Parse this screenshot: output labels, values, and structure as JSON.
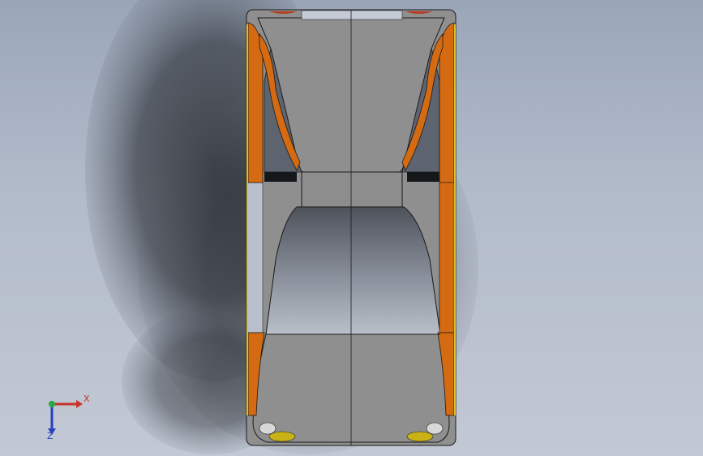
{
  "viewport": {
    "view": "top",
    "background_gradient": [
      "#9aa6b8",
      "#b3bccb",
      "#c2c9d4"
    ]
  },
  "model": {
    "body_color": "#8f8f8f",
    "body_highlight": "#a3a3a3",
    "panel_dark": "#5b6069",
    "accent_orange": "#d46a12",
    "accent_yellow": "#d9c21a",
    "glass_color": "#bfc6d4"
  },
  "triad": {
    "x_label": "X",
    "z_label": "Z",
    "x_color": "#c8322b",
    "y_color": "#2ea646",
    "z_color": "#2a3fbf"
  }
}
